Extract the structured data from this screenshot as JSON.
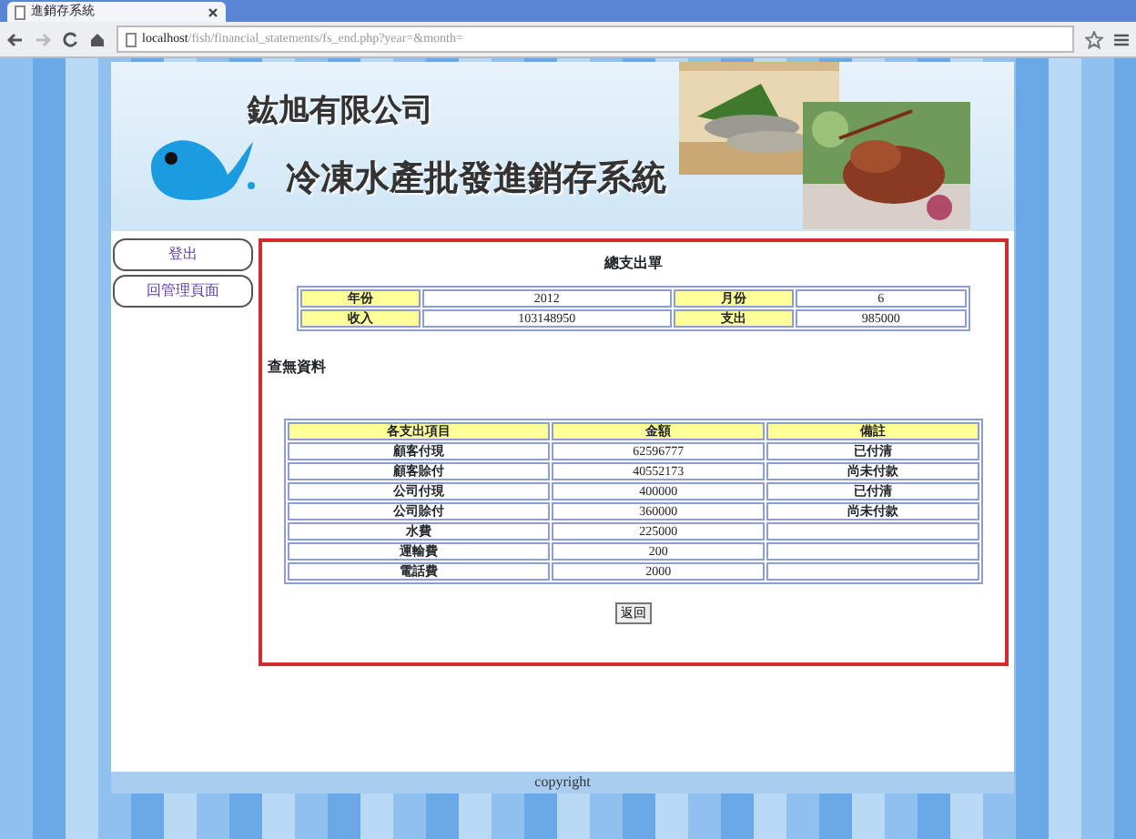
{
  "browser": {
    "tab_title": "進銷存系統",
    "url_host": "localhost",
    "url_path": "/fish/financial_statements/fs_end.php?year=&month="
  },
  "header": {
    "company": "鈜旭有限公司",
    "system_title": "冷凍水產批發進銷存系統"
  },
  "sidebar": {
    "items": [
      {
        "label": "登出"
      },
      {
        "label": "回管理頁面"
      }
    ]
  },
  "report": {
    "title": "總支出單",
    "summary": [
      [
        {
          "label": "年份",
          "value": "2012"
        },
        {
          "label": "月份",
          "value": "6"
        }
      ],
      [
        {
          "label": "收入",
          "value": "103148950"
        },
        {
          "label": "支出",
          "value": "985000"
        }
      ]
    ],
    "notice": "查無資料",
    "table": {
      "columns": [
        "各支出項目",
        "金額",
        "備註"
      ],
      "rows": [
        [
          "顧客付現",
          "62596777",
          "已付清"
        ],
        [
          "顧客賒付",
          "40552173",
          "尚未付款"
        ],
        [
          "公司付現",
          "400000",
          "已付清"
        ],
        [
          "公司賒付",
          "360000",
          "尚未付款"
        ],
        [
          "水費",
          "225000",
          ""
        ],
        [
          "運輸費",
          "200",
          ""
        ],
        [
          "電話費",
          "2000",
          ""
        ]
      ]
    },
    "back_button": "返回"
  },
  "footer": {
    "text": "copyright"
  }
}
